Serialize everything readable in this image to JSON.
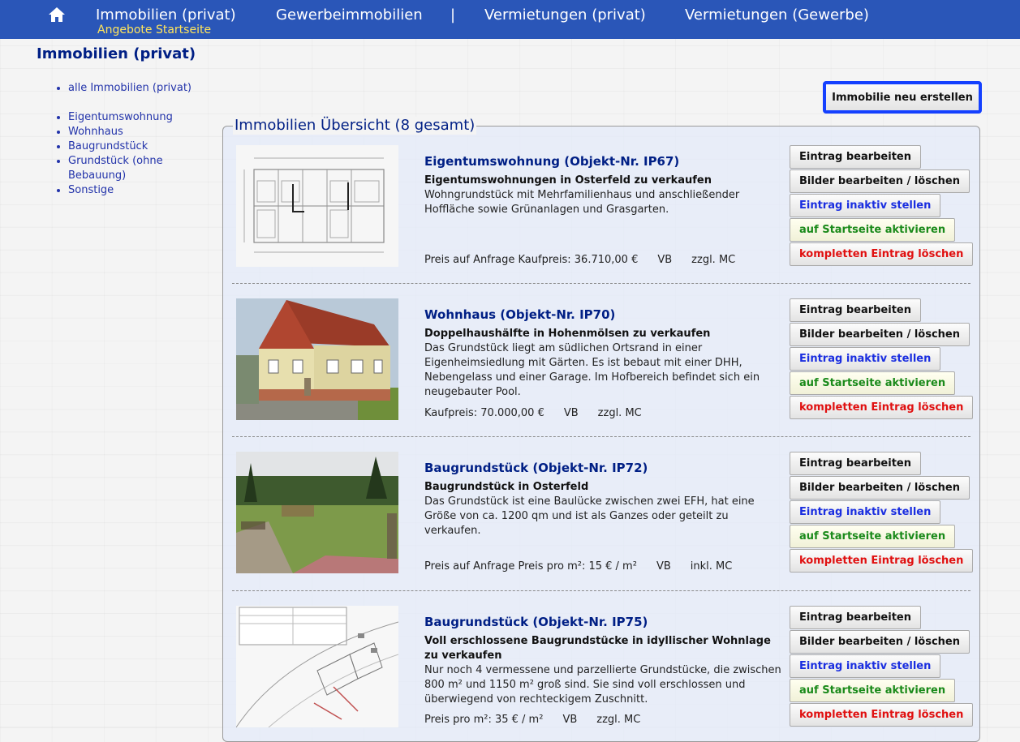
{
  "nav": {
    "items": [
      "Immobilien (privat)",
      "Gewerbeimmobilien",
      "|",
      "Vermietungen (privat)",
      "Vermietungen (Gewerbe)"
    ],
    "sub_label": "Angebote Startseite"
  },
  "page": {
    "title": "Immobilien (privat)"
  },
  "sidebar": {
    "all_link": "alle Immobilien (privat)",
    "categories": [
      "Eigentumswohnung",
      "Wohnhaus",
      "Baugrundstück",
      "Grundstück (ohne Bebauung)",
      "Sonstige"
    ]
  },
  "create_button": "Immobilie neu erstellen",
  "overview": {
    "legend": "Immobilien Übersicht (8 gesamt)",
    "buttons": {
      "edit": "Eintrag bearbeiten",
      "pics": "Bilder bearbeiten / löschen",
      "inactive": "Eintrag inaktiv stellen",
      "activate": "auf Startseite aktivieren",
      "delete": "kompletten Eintrag löschen"
    },
    "entries": [
      {
        "title": "Eigentumswohnung (Objekt-Nr. IP67)",
        "subtitle": "Eigentumswohnungen in Osterfeld zu verkaufen",
        "desc": "Wohngrundstück mit Mehrfamilienhaus und anschließender Hoffläche sowie Grünanlagen und Grasgarten.",
        "price": "Preis auf Anfrage Kaufpreis: 36.710,00 €",
        "vb": "VB",
        "mc": "zzgl. MC"
      },
      {
        "title": "Wohnhaus (Objekt-Nr. IP70)",
        "subtitle": "Doppelhaushälfte in Hohenmölsen zu verkaufen",
        "desc": "Das Grundstück liegt am südlichen Ortsrand in einer Eigenheimsiedlung mit Gärten. Es ist bebaut mit einer DHH, Nebengelass und einer Garage. Im Hofbereich befindet sich ein neugebauter Pool.",
        "price": "Kaufpreis: 70.000,00 €",
        "vb": "VB",
        "mc": "zzgl. MC"
      },
      {
        "title": "Baugrundstück (Objekt-Nr. IP72)",
        "subtitle": "Baugrundstück in Osterfeld",
        "desc": "Das Grundstück ist eine Baulücke zwischen zwei EFH, hat eine Größe von ca. 1200 qm und ist als Ganzes oder geteilt zu verkaufen.",
        "price": "Preis auf Anfrage Preis pro m²: 15 € / m²",
        "vb": "VB",
        "mc": "inkl. MC"
      },
      {
        "title": "Baugrundstück (Objekt-Nr. IP75)",
        "subtitle": "Voll erschlossene Baugrundstücke in idyllischer Wohnlage zu verkaufen",
        "desc": "Nur noch 4 vermessene und parzellierte Grundstücke, die zwischen 800 m² und 1150 m² groß sind. Sie sind voll erschlossen und überwiegend von rechteckigem Zuschnitt.",
        "price": "Preis pro m²: 35 € / m²",
        "vb": "VB",
        "mc": "zzgl. MC"
      }
    ]
  }
}
